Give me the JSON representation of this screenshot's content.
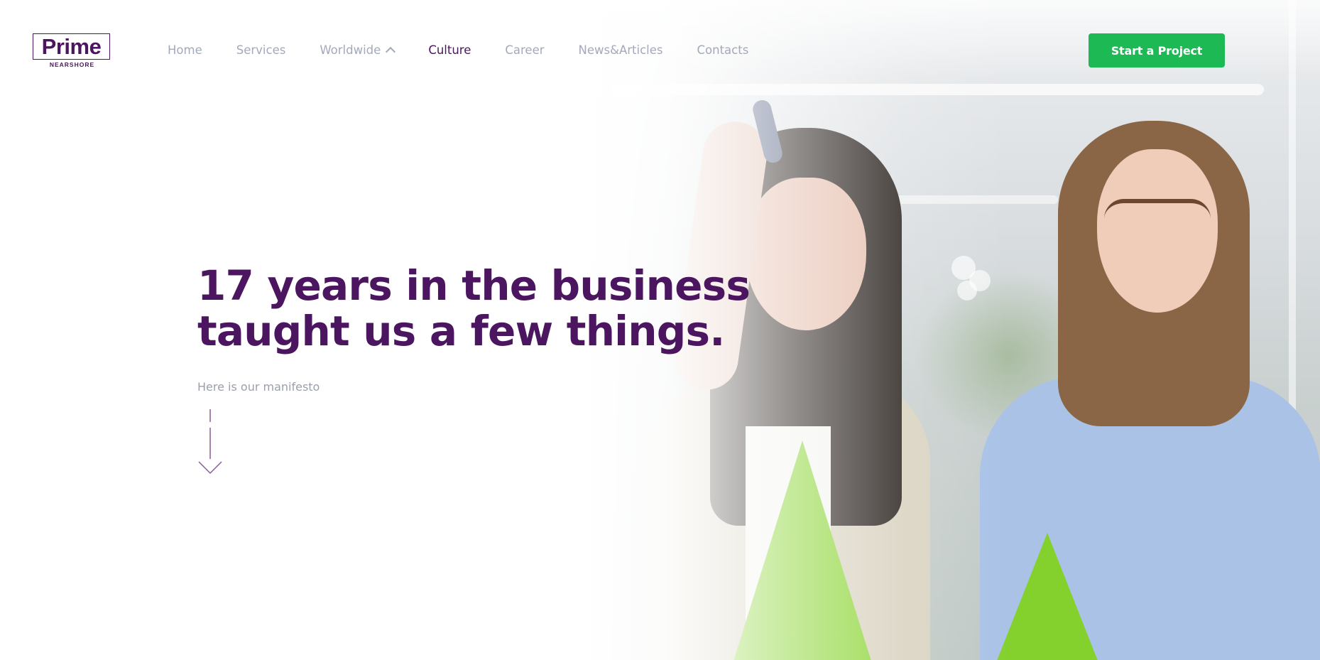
{
  "brand": {
    "name": "Prime",
    "tagline": "NEARSHORE",
    "primary_color": "#4b1560",
    "accent_color": "#1db954"
  },
  "nav": {
    "items": [
      {
        "label": "Home",
        "active": false
      },
      {
        "label": "Services",
        "active": false
      },
      {
        "label": "Worldwide",
        "active": false,
        "icon": "chevron-up-icon"
      },
      {
        "label": "Culture",
        "active": true
      },
      {
        "label": "Career",
        "active": false
      },
      {
        "label": "News&Articles",
        "active": false
      },
      {
        "label": "Contacts",
        "active": false
      }
    ]
  },
  "header": {
    "cta_label": "Start a Project"
  },
  "hero": {
    "headline_line1": "17 years in the business",
    "headline_line2": "taught us a few things.",
    "subline": "Here is our manifesto",
    "scroll_icon": "arrow-down-icon",
    "image": "two-women-writing-on-glass-photo"
  }
}
